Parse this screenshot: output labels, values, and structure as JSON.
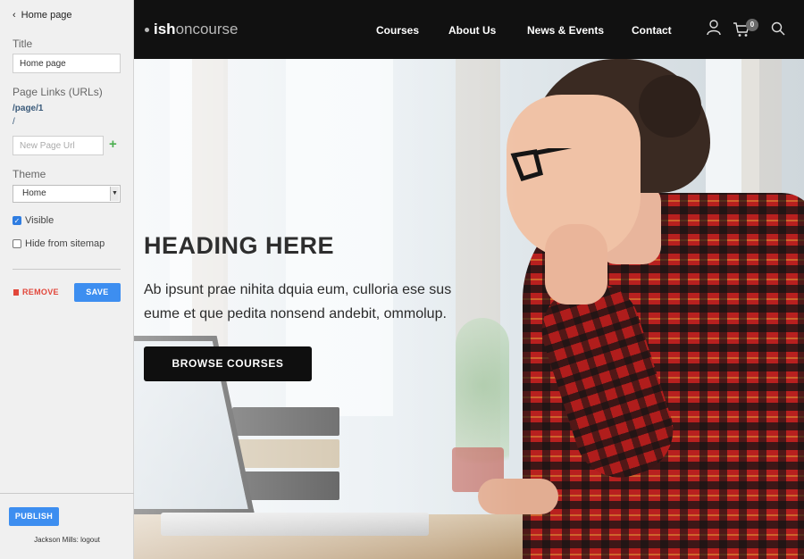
{
  "sidebar": {
    "back_label": "Home page",
    "title_label": "Title",
    "title_value": "Home page",
    "links_label": "Page Links (URLs)",
    "links": [
      "/page/1",
      "/"
    ],
    "new_url_placeholder": "New Page Url",
    "add_icon": "plus-icon",
    "theme_label": "Theme",
    "theme_value": "Home",
    "visible_label": "Visible",
    "visible_checked": true,
    "hide_sitemap_label": "Hide from sitemap",
    "hide_sitemap_checked": false,
    "remove_label": "REMOVE",
    "save_label": "SAVE",
    "publish_label": "PUBLISH",
    "user_line": "Jackson Mills: logout"
  },
  "site": {
    "logo_part1": "ish",
    "logo_part2": "oncourse",
    "nav": [
      "Courses",
      "About Us",
      "News & Events",
      "Contact"
    ],
    "cart_count": "0",
    "icons": [
      "user-icon",
      "cart-icon",
      "search-icon"
    ],
    "hero_heading": "HEADING HERE",
    "hero_text": "Ab ipsunt prae nihita dquia eum, culloria ese sus eume et que pedita nonsend andebit, ommolup.",
    "hero_button": "BROWSE COURSES"
  },
  "colors": {
    "accent": "#3d8ef0",
    "danger": "#e2473b",
    "add": "#4caf50",
    "nav_bg": "#111111",
    "sidebar_bg": "#f0f0f0"
  }
}
